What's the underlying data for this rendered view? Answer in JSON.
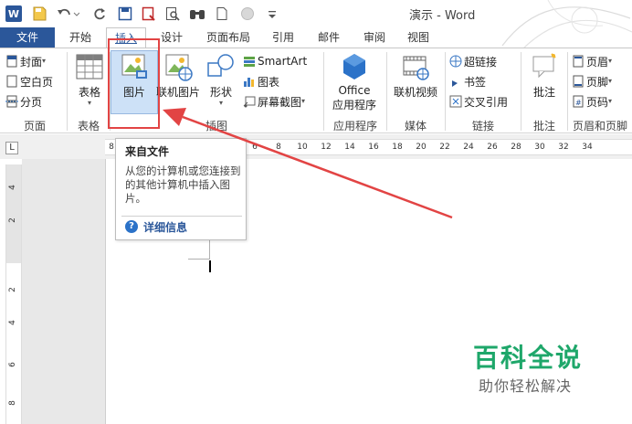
{
  "window": {
    "app_icon": "W",
    "title": "演示 - Word",
    "quick_access": [
      "save-icon",
      "undo-icon",
      "redo-icon",
      "save-as-icon",
      "print-preview-icon",
      "find-icon",
      "new-doc-icon",
      "circle-icon",
      "customize-icon"
    ]
  },
  "tabs": [
    "文件",
    "开始",
    "插入",
    "设计",
    "页面布局",
    "引用",
    "邮件",
    "审阅",
    "视图"
  ],
  "active_tab": "插入",
  "ribbon": {
    "pages": {
      "cover": "封面",
      "blank_page": "空白页",
      "page_break": "分页",
      "label": "页面"
    },
    "tables": {
      "table": "表格",
      "label": "表格"
    },
    "illustrations": {
      "picture": "图片",
      "online_picture": "联机图片",
      "shapes": "形状",
      "smartart": "SmartArt",
      "chart": "图表",
      "screenshot": "屏幕截图",
      "label": "插图"
    },
    "apps": {
      "office_line1": "Office",
      "office_line2": "应用程序",
      "label": "应用程序"
    },
    "media": {
      "online_video": "联机视频",
      "label": "媒体"
    },
    "links": {
      "hyperlink": "超链接",
      "bookmark": "书签",
      "cross_reference": "交叉引用",
      "label": "链接"
    },
    "comments": {
      "comment": "批注",
      "label": "批注"
    },
    "header_footer": {
      "header": "页眉",
      "footer": "页脚",
      "page_number": "页码",
      "label": "页眉和页脚"
    }
  },
  "ruler": {
    "corner": "L",
    "h_numbers": [
      "8",
      "6",
      "8",
      "10",
      "12",
      "14",
      "16",
      "18",
      "20",
      "22",
      "24",
      "26",
      "28",
      "30",
      "32",
      "34"
    ],
    "v_numbers": [
      "4",
      "2",
      "2",
      "4",
      "6",
      "8"
    ]
  },
  "tooltip": {
    "title": "来自文件",
    "body": "从您的计算机或您连接到的其他计算机中插入图片。",
    "help_icon": "?",
    "help_link": "详细信息"
  },
  "watermark": {
    "title": "百科全说",
    "subtitle": "助你轻松解决"
  },
  "colors": {
    "word_blue": "#2b579a",
    "highlight_red": "#e24444",
    "watermark_green": "#1ea76a"
  }
}
